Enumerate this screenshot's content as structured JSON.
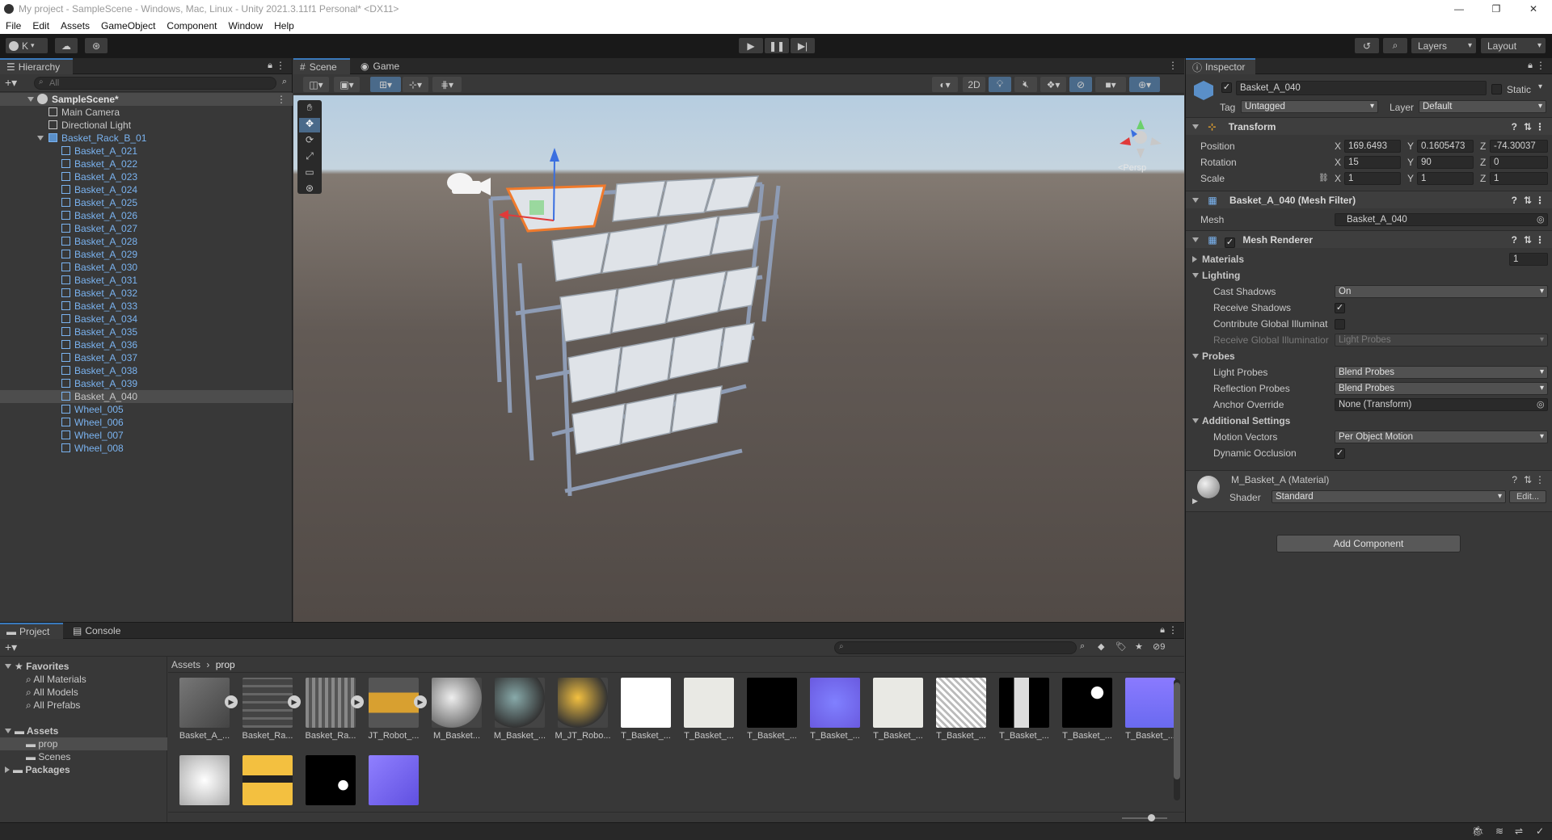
{
  "window": {
    "title": "My project - SampleScene - Windows, Mac, Linux - Unity 2021.3.11f1 Personal* <DX11>"
  },
  "menu": [
    "File",
    "Edit",
    "Assets",
    "GameObject",
    "Component",
    "Window",
    "Help"
  ],
  "toolbar": {
    "account_label": "K",
    "layers_label": "Layers",
    "layout_label": "Layout"
  },
  "hierarchy": {
    "tab": "Hierarchy",
    "search_placeholder": "All",
    "scene": "SampleScene*",
    "items": [
      {
        "label": "Main Camera",
        "indent": 2,
        "blue": false
      },
      {
        "label": "Directional Light",
        "indent": 2,
        "blue": false
      },
      {
        "label": "Basket_Rack_B_01",
        "indent": 2,
        "blue": true,
        "expand": true
      },
      {
        "label": "Basket_A_021",
        "indent": 3,
        "blue": true
      },
      {
        "label": "Basket_A_022",
        "indent": 3,
        "blue": true
      },
      {
        "label": "Basket_A_023",
        "indent": 3,
        "blue": true
      },
      {
        "label": "Basket_A_024",
        "indent": 3,
        "blue": true
      },
      {
        "label": "Basket_A_025",
        "indent": 3,
        "blue": true
      },
      {
        "label": "Basket_A_026",
        "indent": 3,
        "blue": true
      },
      {
        "label": "Basket_A_027",
        "indent": 3,
        "blue": true
      },
      {
        "label": "Basket_A_028",
        "indent": 3,
        "blue": true
      },
      {
        "label": "Basket_A_029",
        "indent": 3,
        "blue": true
      },
      {
        "label": "Basket_A_030",
        "indent": 3,
        "blue": true
      },
      {
        "label": "Basket_A_031",
        "indent": 3,
        "blue": true
      },
      {
        "label": "Basket_A_032",
        "indent": 3,
        "blue": true
      },
      {
        "label": "Basket_A_033",
        "indent": 3,
        "blue": true
      },
      {
        "label": "Basket_A_034",
        "indent": 3,
        "blue": true
      },
      {
        "label": "Basket_A_035",
        "indent": 3,
        "blue": true
      },
      {
        "label": "Basket_A_036",
        "indent": 3,
        "blue": true
      },
      {
        "label": "Basket_A_037",
        "indent": 3,
        "blue": true
      },
      {
        "label": "Basket_A_038",
        "indent": 3,
        "blue": true
      },
      {
        "label": "Basket_A_039",
        "indent": 3,
        "blue": true
      },
      {
        "label": "Basket_A_040",
        "indent": 3,
        "blue": false,
        "selected": true
      },
      {
        "label": "Wheel_005",
        "indent": 3,
        "blue": true
      },
      {
        "label": "Wheel_006",
        "indent": 3,
        "blue": true
      },
      {
        "label": "Wheel_007",
        "indent": 3,
        "blue": true
      },
      {
        "label": "Wheel_008",
        "indent": 3,
        "blue": true
      }
    ]
  },
  "scene": {
    "tab_scene": "Scene",
    "tab_game": "Game",
    "btn_2d": "2D",
    "persp_label": "<Persp"
  },
  "inspector": {
    "tab": "Inspector",
    "object_name": "Basket_A_040",
    "static_label": "Static",
    "tag_label": "Tag",
    "tag_value": "Untagged",
    "layer_label": "Layer",
    "layer_value": "Default",
    "transform": {
      "title": "Transform",
      "position_label": "Position",
      "rotation_label": "Rotation",
      "scale_label": "Scale",
      "position": {
        "x": "169.6493",
        "y": "0.1605473",
        "z": "-74.30037"
      },
      "rotation": {
        "x": "15",
        "y": "90",
        "z": "0"
      },
      "scale": {
        "x": "1",
        "y": "1",
        "z": "1"
      }
    },
    "mesh_filter": {
      "title": "Basket_A_040 (Mesh Filter)",
      "mesh_label": "Mesh",
      "mesh_value": "Basket_A_040"
    },
    "mesh_renderer": {
      "title": "Mesh Renderer",
      "materials_label": "Materials",
      "materials_count": "1",
      "lighting_label": "Lighting",
      "cast_shadows_label": "Cast Shadows",
      "cast_shadows_value": "On",
      "receive_shadows_label": "Receive Shadows",
      "contribute_gi_label": "Contribute Global Illuminat",
      "receive_gi_label": "Receive Global Illuminatior",
      "receive_gi_value": "Light Probes",
      "probes_label": "Probes",
      "light_probes_label": "Light Probes",
      "light_probes_value": "Blend Probes",
      "reflection_probes_label": "Reflection Probes",
      "reflection_probes_value": "Blend Probes",
      "anchor_override_label": "Anchor Override",
      "anchor_override_value": "None (Transform)",
      "additional_label": "Additional Settings",
      "motion_vectors_label": "Motion Vectors",
      "motion_vectors_value": "Per Object Motion",
      "dynamic_occlusion_label": "Dynamic Occlusion"
    },
    "material": {
      "title": "M_Basket_A (Material)",
      "shader_label": "Shader",
      "shader_value": "Standard",
      "edit_label": "Edit..."
    },
    "add_component": "Add Component"
  },
  "project": {
    "tab_project": "Project",
    "tab_console": "Console",
    "favorites_label": "Favorites",
    "favorites": [
      "All Materials",
      "All Models",
      "All Prefabs"
    ],
    "assets_label": "Assets",
    "assets_children": [
      "prop",
      "Scenes"
    ],
    "packages_label": "Packages",
    "breadcrumb": [
      "Assets",
      "prop"
    ],
    "hidden_count": "9",
    "assets": [
      {
        "label": "Basket_A_...",
        "kind": "model"
      },
      {
        "label": "Basket_Ra...",
        "kind": "model-rack"
      },
      {
        "label": "Basket_Ra...",
        "kind": "model-grid"
      },
      {
        "label": "JT_Robot_...",
        "kind": "model-robot"
      },
      {
        "label": "M_Basket...",
        "kind": "mat-white"
      },
      {
        "label": "M_Basket_...",
        "kind": "mat-dark"
      },
      {
        "label": "M_JT_Robo...",
        "kind": "mat-yellow"
      },
      {
        "label": "T_Basket_...",
        "kind": "tex-white"
      },
      {
        "label": "T_Basket_...",
        "kind": "tex-light"
      },
      {
        "label": "T_Basket_...",
        "kind": "tex-black"
      },
      {
        "label": "T_Basket_...",
        "kind": "tex-normal"
      },
      {
        "label": "T_Basket_...",
        "kind": "tex-light"
      },
      {
        "label": "T_Basket_...",
        "kind": "tex-noise"
      },
      {
        "label": "T_Basket_...",
        "kind": "tex-bw"
      },
      {
        "label": "T_Basket_...",
        "kind": "tex-blackspot"
      },
      {
        "label": "T_Basket_...",
        "kind": "tex-normal2"
      }
    ],
    "assets_row2": [
      {
        "kind": "tex-ao"
      },
      {
        "kind": "tex-yellow"
      },
      {
        "kind": "tex-mask"
      },
      {
        "kind": "tex-normal3"
      }
    ]
  }
}
